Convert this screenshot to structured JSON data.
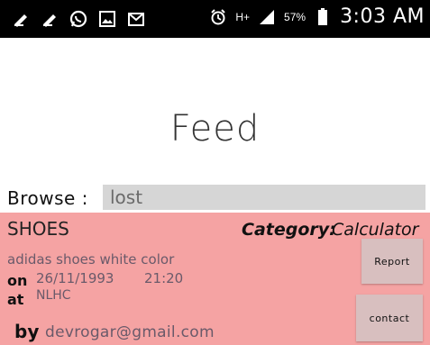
{
  "status_bar": {
    "network": "H+",
    "battery": "57%",
    "time": "3:03 AM",
    "icons": [
      "usb-icon",
      "usb-icon",
      "whatsapp-icon",
      "image-icon",
      "gmail-icon",
      "alarm-icon",
      "network-hplus-icon",
      "signal-icon",
      "battery-icon"
    ]
  },
  "page": {
    "title": "Feed"
  },
  "browse": {
    "label": "Browse :",
    "value": "lost"
  },
  "item": {
    "name": "SHOES",
    "category_label": "Category:",
    "category_value": "Calculator",
    "description": "adidas shoes white color",
    "on_label": "on",
    "date": "26/11/1993",
    "time": "21:20",
    "at_label": "at",
    "place": "NLHC",
    "by_label": "by",
    "email": "devrogar@gmail.com",
    "report_label": "Report",
    "contact_label": "contact"
  },
  "colors": {
    "card_bg": "#f5a3a3",
    "button_bg": "#d8bfbf",
    "input_bg": "#d6d6d6",
    "status_bar_bg": "#000000"
  }
}
